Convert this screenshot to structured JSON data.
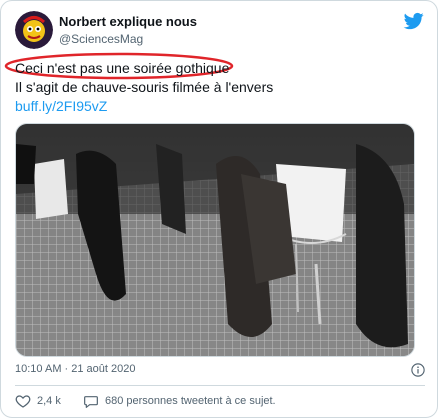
{
  "tweet": {
    "display_name": "Norbert explique nous",
    "handle": "@SciencesMag",
    "text_line_1": "Ceci n'est pas une soirée gothique",
    "text_line_2": "Il s'agit de chauve-souris filmée à l'envers",
    "link": "buff.ly/2FI95vZ",
    "timestamp": "10:10 AM · 21 août 2020",
    "like_count": "2,4 k",
    "reply_text": "680 personnes tweetent à ce sujet."
  },
  "icons": {
    "brand": "twitter-bird-icon",
    "info": "info-icon",
    "like": "heart-icon",
    "reply": "speech-bubble-icon"
  },
  "colors": {
    "brand_blue": "#1d9bf0",
    "highlight_red": "#e0252a",
    "muted_text": "#536471",
    "border": "#cfd9de"
  }
}
